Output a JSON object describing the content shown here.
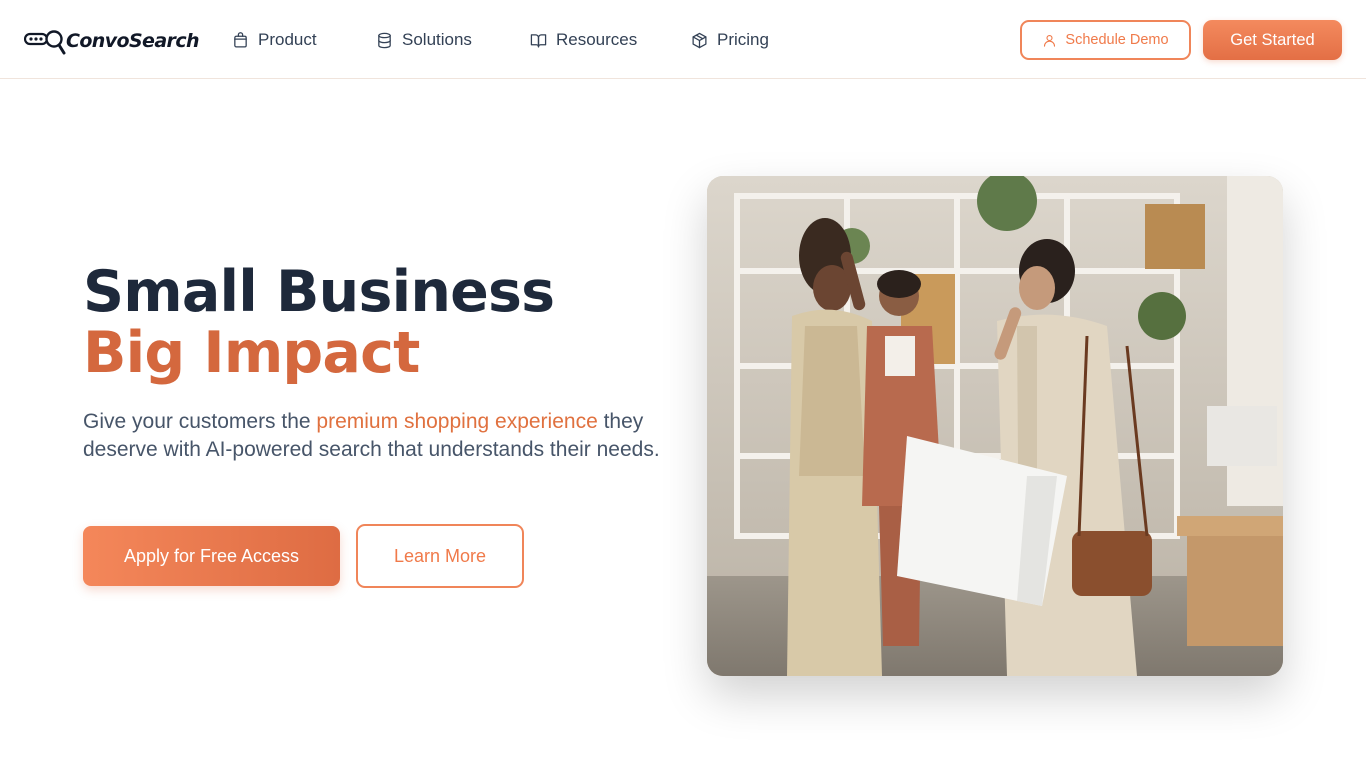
{
  "brand": {
    "name": "ConvoSearch"
  },
  "nav": {
    "items": [
      {
        "label": "Product",
        "icon": "shopping-bag-icon"
      },
      {
        "label": "Solutions",
        "icon": "database-icon"
      },
      {
        "label": "Resources",
        "icon": "book-icon"
      },
      {
        "label": "Pricing",
        "icon": "box-icon"
      }
    ],
    "schedule_demo_label": "Schedule Demo",
    "get_started_label": "Get Started"
  },
  "hero": {
    "title_line1": "Small Business",
    "title_line2": "Big Impact",
    "lead_before": "Give your customers the ",
    "lead_highlight": "premium shopping experience",
    "lead_after": " they deserve with AI-powered search that understands their needs.",
    "apply_label": "Apply for Free Access",
    "learn_label": "Learn More"
  },
  "colors": {
    "accent": "#f07a4a",
    "accent_dark": "#d4683e",
    "heading": "#1e293b",
    "body_text": "#475569"
  }
}
